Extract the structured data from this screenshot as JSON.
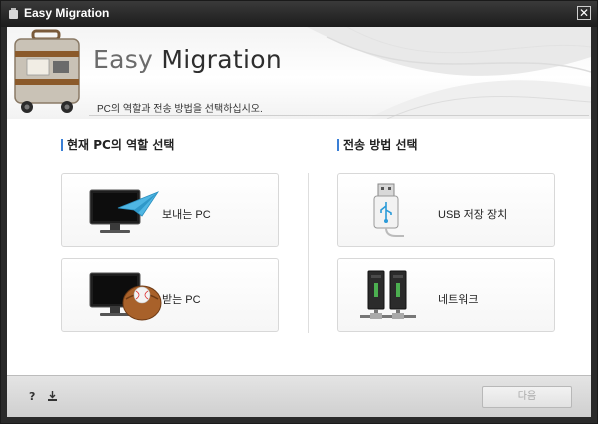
{
  "window": {
    "title": "Easy Migration",
    "close_glyph": "✕"
  },
  "header": {
    "title_light": "Easy",
    "title_bold": "Migration",
    "subtitle": "PC의 역할과 전송 방법을 선택하십시오."
  },
  "role_section": {
    "title": "현재 PC의 역할 선택",
    "options": [
      {
        "label": "보내는 PC",
        "icon": "monitor-paper-plane-icon"
      },
      {
        "label": "받는 PC",
        "icon": "monitor-baseball-glove-icon"
      }
    ]
  },
  "method_section": {
    "title": "전송 방법 선택",
    "options": [
      {
        "label": "USB 저장 장치",
        "icon": "usb-drive-icon"
      },
      {
        "label": "네트워크",
        "icon": "network-icon"
      }
    ]
  },
  "footer": {
    "help_label": "?",
    "next_label": "다음"
  },
  "colors": {
    "accent": "#3a7fd6",
    "titlebar": "#1c1c1c"
  }
}
